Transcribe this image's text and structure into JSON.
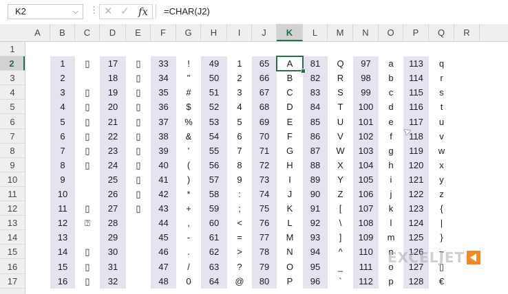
{
  "name_box": {
    "value": "K2"
  },
  "formula_bar": {
    "formula": "=CHAR(J2)",
    "fx_label": "fx",
    "cancel_icon": "close-icon",
    "enter_icon": "check-icon"
  },
  "columns": [
    "A",
    "B",
    "C",
    "D",
    "E",
    "F",
    "G",
    "H",
    "I",
    "J",
    "K",
    "L",
    "M",
    "N",
    "O",
    "P",
    "Q",
    "R"
  ],
  "active_column": "K",
  "active_row": 2,
  "active_cell": "K2",
  "rows": [
    "1",
    "2",
    "3",
    "4",
    "5",
    "6",
    "7",
    "8",
    "9",
    "10",
    "11",
    "12",
    "13",
    "14",
    "15",
    "16",
    "17"
  ],
  "colors": {
    "shade": "#e6e2f0",
    "selection": "#217346",
    "watermark_badge": "#f08a24"
  },
  "table_rows": [
    [
      "1",
      "▯",
      "17",
      "▯",
      "33",
      "!",
      "49",
      "1",
      "65",
      "A",
      "81",
      "Q",
      "97",
      "a",
      "113",
      "q"
    ],
    [
      "2",
      "",
      "18",
      "▯",
      "34",
      "\"",
      "50",
      "2",
      "66",
      "B",
      "82",
      "R",
      "98",
      "b",
      "114",
      "r"
    ],
    [
      "3",
      "▯",
      "19",
      "▯",
      "35",
      "#",
      "51",
      "3",
      "67",
      "C",
      "83",
      "S",
      "99",
      "c",
      "115",
      "s"
    ],
    [
      "4",
      "▯",
      "20",
      "▯",
      "36",
      "$",
      "52",
      "4",
      "68",
      "D",
      "84",
      "T",
      "100",
      "d",
      "116",
      "t"
    ],
    [
      "5",
      "▯",
      "21",
      "▯",
      "37",
      "%",
      "53",
      "5",
      "69",
      "E",
      "85",
      "U",
      "101",
      "e",
      "117",
      "u"
    ],
    [
      "6",
      "▯",
      "22",
      "▯",
      "38",
      "&",
      "54",
      "6",
      "70",
      "F",
      "86",
      "V",
      "102",
      "f",
      "118",
      "v"
    ],
    [
      "7",
      "▯",
      "23",
      "▯",
      "39",
      "'",
      "55",
      "7",
      "71",
      "G",
      "87",
      "W",
      "103",
      "g",
      "119",
      "w"
    ],
    [
      "8",
      "▯",
      "24",
      "▯",
      "40",
      "(",
      "56",
      "8",
      "72",
      "H",
      "88",
      "X",
      "104",
      "h",
      "120",
      "x"
    ],
    [
      "9",
      "",
      "25",
      "▯",
      "41",
      ")",
      "57",
      "9",
      "73",
      "I",
      "89",
      "Y",
      "105",
      "i",
      "121",
      "y"
    ],
    [
      "10",
      "",
      "26",
      "▯",
      "42",
      "*",
      "58",
      ":",
      "74",
      "J",
      "90",
      "Z",
      "106",
      "j",
      "122",
      "z"
    ],
    [
      "11",
      "▯",
      "27",
      "▯",
      "43",
      "+",
      "59",
      ";",
      "75",
      "K",
      "91",
      "[",
      "107",
      "k",
      "123",
      "{"
    ],
    [
      "12",
      "⍰",
      "28",
      "",
      "44",
      ",",
      "60",
      "<",
      "76",
      "L",
      "92",
      "\\",
      "108",
      "l",
      "124",
      "|"
    ],
    [
      "13",
      "",
      "29",
      "",
      "45",
      "-",
      "61",
      "=",
      "77",
      "M",
      "93",
      "]",
      "109",
      "m",
      "125",
      "}"
    ],
    [
      "14",
      "▯",
      "30",
      "",
      "46",
      ".",
      "62",
      ">",
      "78",
      "N",
      "94",
      "^",
      "110",
      "n",
      "126",
      "~"
    ],
    [
      "15",
      "▯",
      "31",
      "",
      "47",
      "/",
      "63",
      "?",
      "79",
      "O",
      "95",
      "_",
      "111",
      "o",
      "127",
      "▯"
    ],
    [
      "16",
      "▯",
      "32",
      "",
      "48",
      "0",
      "64",
      "@",
      "80",
      "P",
      "96",
      "`",
      "112",
      "p",
      "128",
      "€"
    ]
  ],
  "watermark": {
    "text": "EXCELJET"
  }
}
